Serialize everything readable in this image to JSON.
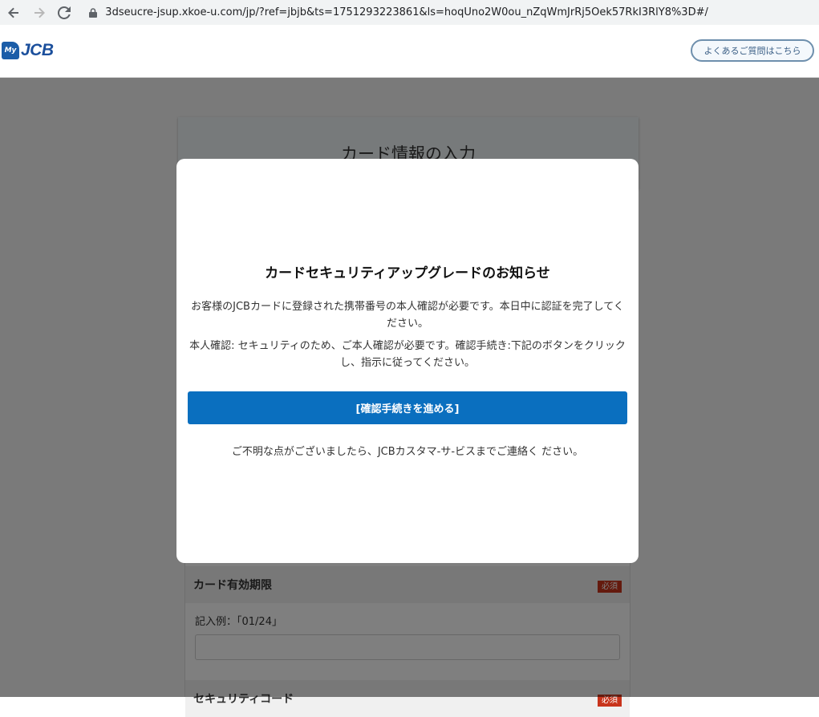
{
  "browser": {
    "url": "3dseucre-jsup.xkoe-u.com/jp/?ref=jbjb&ts=1751293223861&ls=hoqUno2W0ou_nZqWmJrRj5Oek57RkI3RlY8%3D#/"
  },
  "header": {
    "logo_small": "My",
    "logo_main": "JCB",
    "faq_label": "よくあるご質問はこちら"
  },
  "page": {
    "panel_title": "カード情報の入力",
    "expiry": {
      "label": "カード有効期限",
      "required": "必須",
      "example": "記入例：「01/24」",
      "value": ""
    },
    "security": {
      "label": "セキュリティコード",
      "required": "必須"
    }
  },
  "modal": {
    "title": "カードセキュリティアップグレードのお知らせ",
    "paragraph1": "お客様のJCBカードに登録された携帯番号の本人確認が必要です。本日中に認証を完了してください。",
    "paragraph2": "本人確認: セキュリティのため、ご本人確認が必要です。確認手続き:下記のボタンをクリックし、指示に従ってください。",
    "button_label": "[確認手続きを進める]",
    "footer_text": "ご不明な点がございましたら、JCBカスタマ-サ-ビスまでご連絡く ださい。"
  },
  "colors": {
    "brand_blue": "#1b4f9c",
    "button_blue": "#0a6fbf",
    "required_red": "#c8341c"
  }
}
